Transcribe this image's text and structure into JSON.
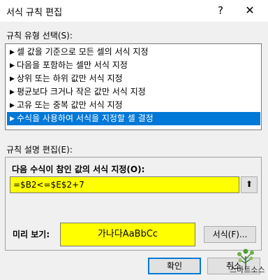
{
  "window": {
    "title": "서식 규칙 편집",
    "help_glyph": "?",
    "close_glyph": "✕"
  },
  "rule_type": {
    "label": "규칙 유형 선택(S):",
    "items": [
      {
        "label": "셀 값을 기준으로 모든 셀의 서식 지정"
      },
      {
        "label": "다음을 포함하는 셀만 서식 지정"
      },
      {
        "label": "상위 또는 하위 값만 서식 지정"
      },
      {
        "label": "평균보다 크거나 작은 값만 서식 지정"
      },
      {
        "label": "고유 또는 중복 값만 서식 지정"
      },
      {
        "label": "수식을 사용하여 서식을 지정할 셀 결정"
      }
    ],
    "selected_index": 5,
    "arrow_glyph": "▶"
  },
  "rule_description": {
    "label": "규칙 설명 편집(E):",
    "formula_label": "다음 수식이 참인 값의 서식 지정(O):",
    "formula_value": "=$B2<=$E$2+7",
    "collapse_glyph": "⬆",
    "preview_label": "미리 보기:",
    "preview_text": "가나다AaBbCc",
    "format_button": "서식(F)..."
  },
  "buttons": {
    "ok": "확인",
    "cancel": "취소"
  },
  "colors": {
    "selection": "#0078d7",
    "highlight": "#ffff00",
    "dialog_bg": "#f0f0f0"
  },
  "watermark": {
    "text": "스마트소스"
  }
}
